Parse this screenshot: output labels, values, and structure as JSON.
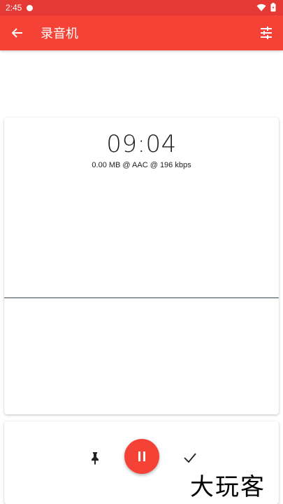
{
  "status_bar": {
    "time": "2:45",
    "icons": [
      "notification-dot-icon",
      "wifi-icon",
      "battery-icon"
    ]
  },
  "app_bar": {
    "title": "录音机",
    "back_icon": "arrow-back-icon",
    "settings_icon": "tune-icon",
    "color": "#f44336"
  },
  "recording": {
    "timer": "09:04",
    "info": "0.00 MB @ AAC @ 196 kbps"
  },
  "controls": {
    "pin_icon": "pin-icon",
    "pause_icon": "pause-icon",
    "done_icon": "check-icon",
    "accent": "#f44336"
  },
  "watermark": "大玩客"
}
